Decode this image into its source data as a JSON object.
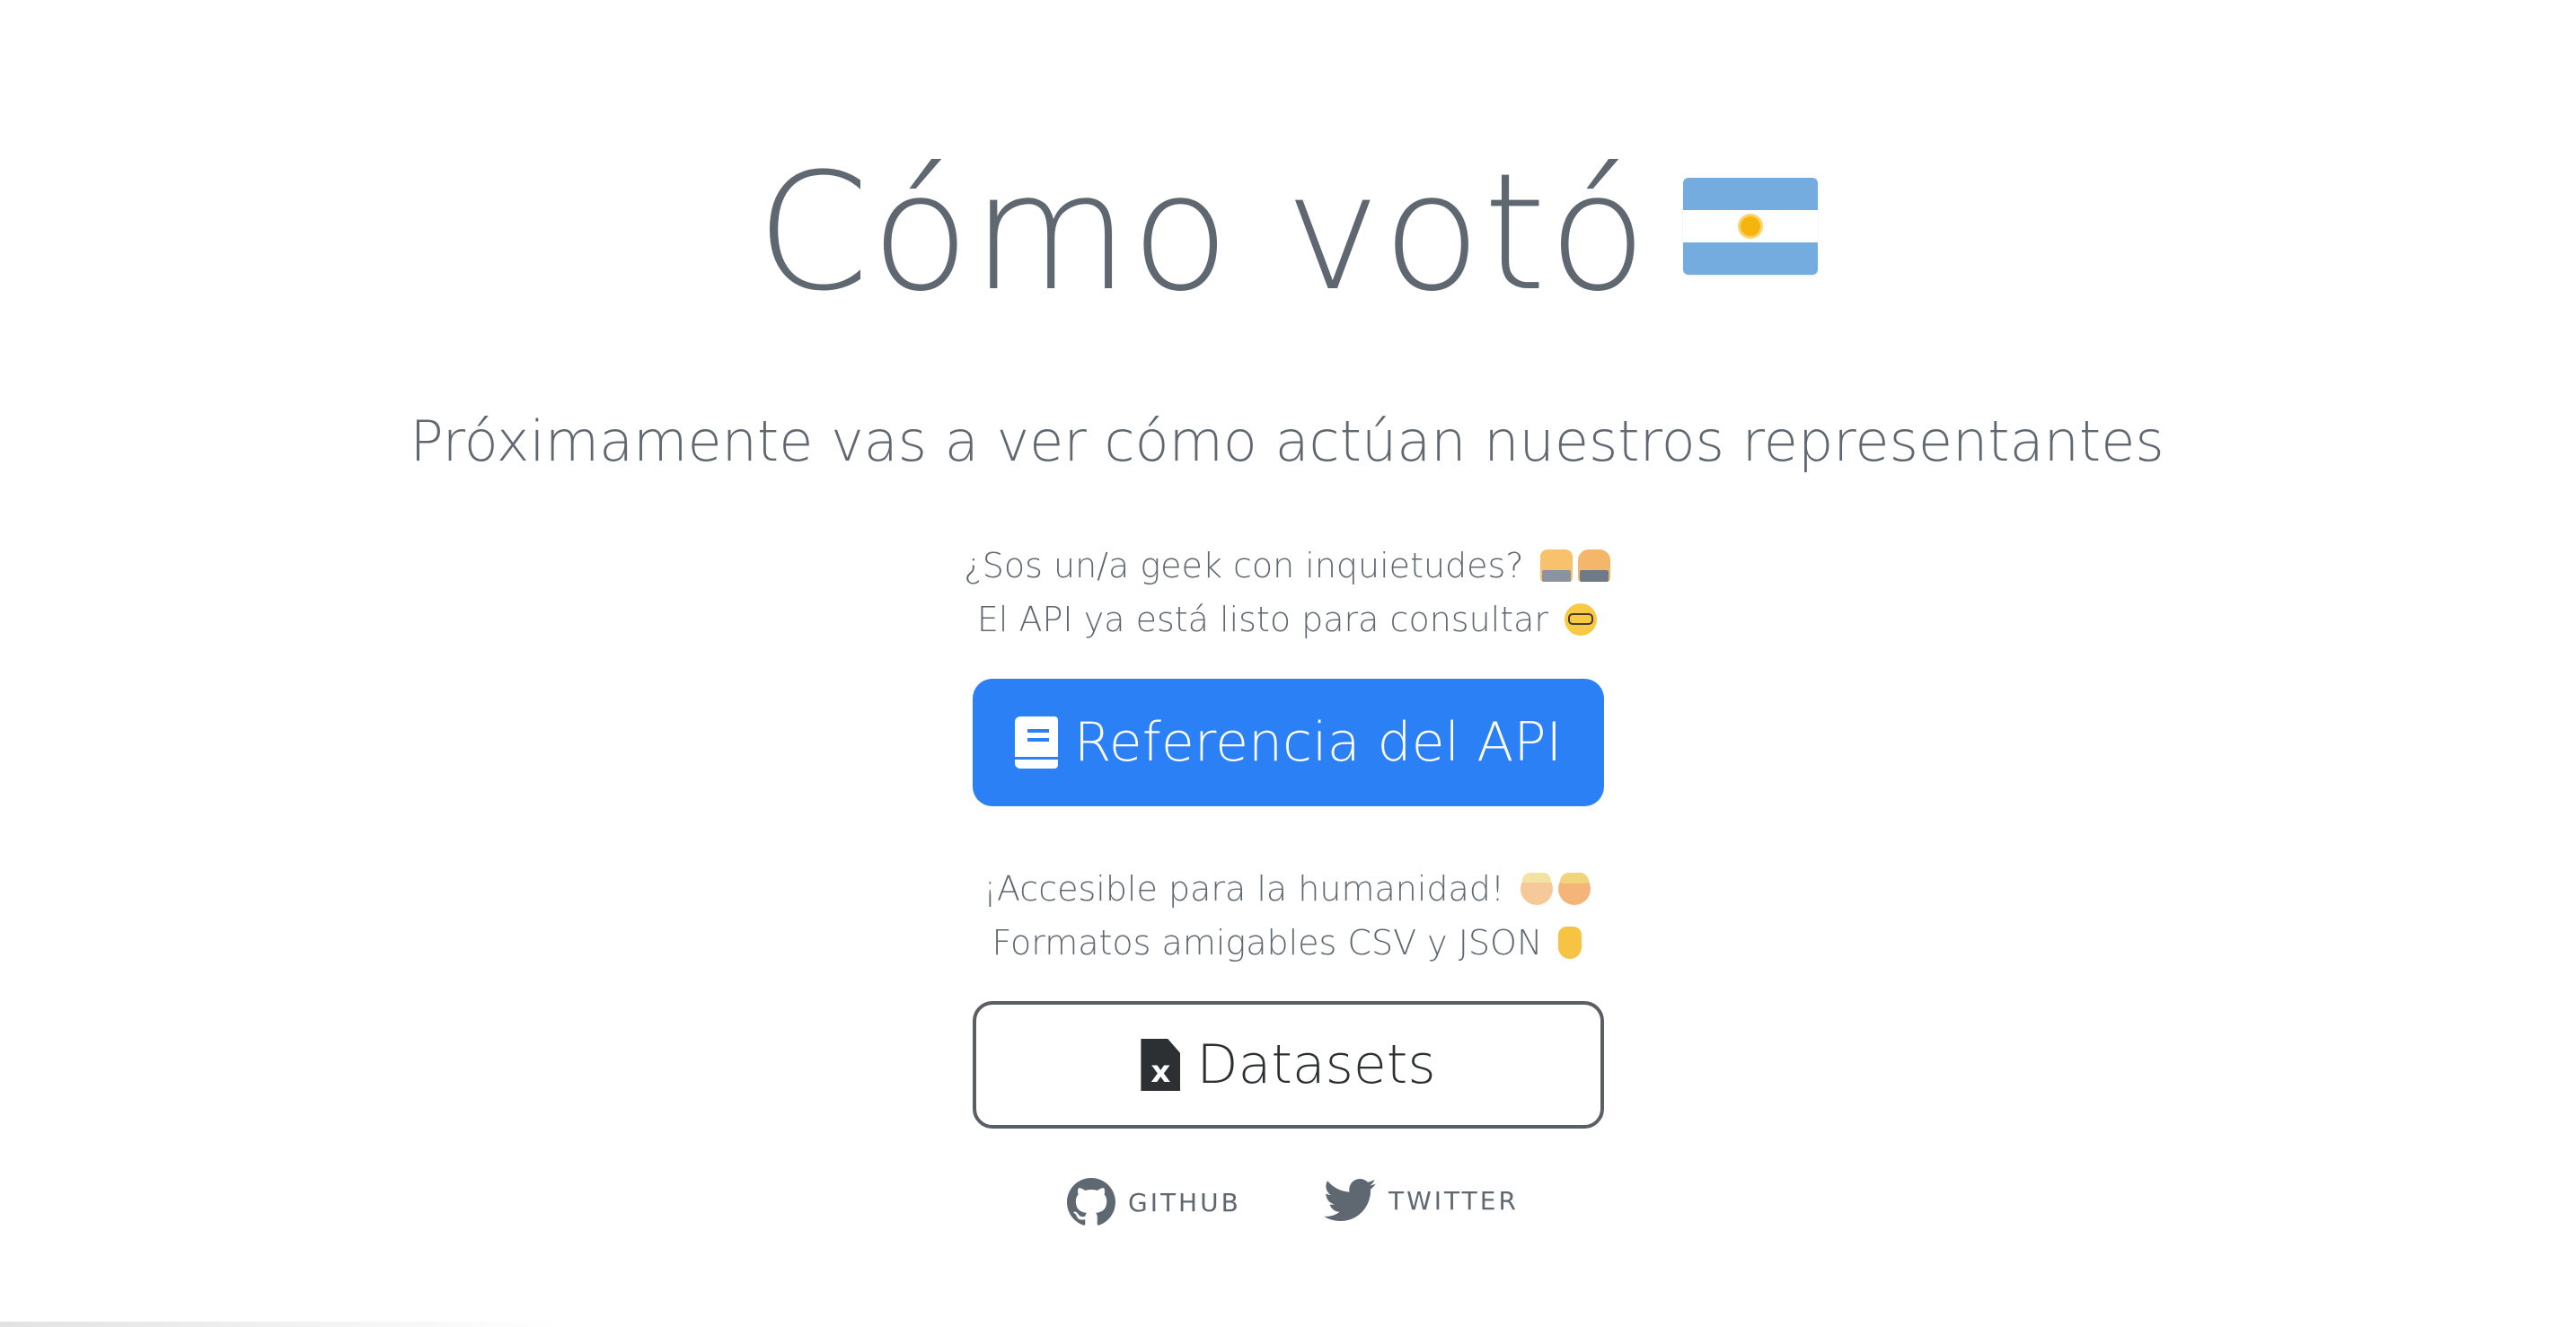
{
  "header": {
    "title": "Cómo votó",
    "flag_icon": "argentina-flag-icon"
  },
  "subtitle": "Próximamente vas a ver cómo actúan nuestros representantes",
  "api_section": {
    "line1": "¿Sos un/a geek con inquietudes?",
    "line1_icons": [
      "technologist-man-icon",
      "technologist-woman-icon"
    ],
    "line2": "El API ya está listo para consultar",
    "line2_icons": [
      "nerd-face-icon"
    ],
    "button_label": "Referencia del API",
    "button_icon": "book-icon"
  },
  "datasets_section": {
    "line1": "¡Accesible para la humanidad!",
    "line1_icons": [
      "older-person-icon",
      "man-icon"
    ],
    "line2": "Formatos amigables CSV y JSON",
    "line2_icons": [
      "pointing-down-icon"
    ],
    "button_label": "Datasets",
    "button_icon": "excel-file-icon"
  },
  "footer": {
    "github_label": "GITHUB",
    "twitter_label": "TWITTER"
  },
  "colors": {
    "text": "#5f6770",
    "primary": "#2c80f5",
    "outline": "#5a5f66"
  }
}
